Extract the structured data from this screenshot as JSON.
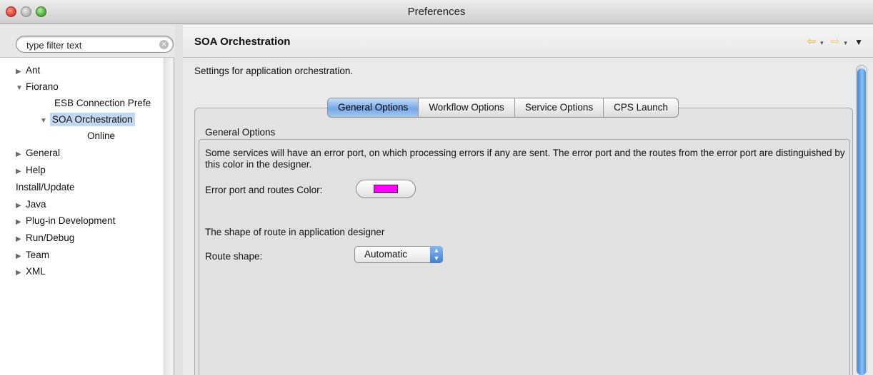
{
  "window": {
    "title": "Preferences"
  },
  "filter": {
    "placeholder": "type filter text",
    "value": "type filter text"
  },
  "tree": {
    "items": [
      {
        "label": "Ant",
        "arrow": "▶"
      },
      {
        "label": "Fiorano",
        "arrow": "▼"
      },
      {
        "label": "ESB Connection Prefe",
        "arrow": ""
      },
      {
        "label": "SOA Orchestration",
        "arrow": "▼"
      },
      {
        "label": "Online",
        "arrow": ""
      },
      {
        "label": "General",
        "arrow": "▶"
      },
      {
        "label": "Help",
        "arrow": "▶"
      },
      {
        "label": "Install/Update",
        "arrow": ""
      },
      {
        "label": "Java",
        "arrow": "▶"
      },
      {
        "label": "Plug-in Development",
        "arrow": "▶"
      },
      {
        "label": "Run/Debug",
        "arrow": "▶"
      },
      {
        "label": "Team",
        "arrow": "▶"
      },
      {
        "label": "XML",
        "arrow": "▶"
      }
    ]
  },
  "page": {
    "title": "SOA Orchestration",
    "description": "Settings for application orchestration."
  },
  "tabs": [
    {
      "label": "General Options"
    },
    {
      "label": "Workflow Options"
    },
    {
      "label": "Service Options"
    },
    {
      "label": "CPS Launch"
    }
  ],
  "general": {
    "group_title": "General Options",
    "description": "Some services will have an error port, on which processing errors if any are sent. The error port and the routes from the error port are distinguished by this color in the designer.",
    "color_label": "Error port and routes Color:",
    "color_value": "#ff00ff",
    "shape_description": "The shape of route in application designer",
    "shape_label": "Route shape:",
    "shape_value": "Automatic"
  },
  "icons": {
    "back": "back-arrow-icon",
    "forward": "forward-arrow-icon",
    "menu": "view-menu-icon"
  }
}
